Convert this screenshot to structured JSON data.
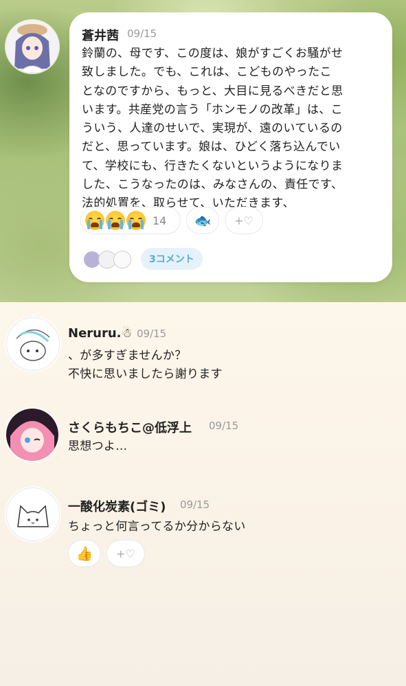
{
  "post": {
    "author": "蒼井茜",
    "date": "09/15",
    "lines": [
      "鈴蘭の、母です、この度は、娘がすごくお騒がせ",
      "致しました。でも、これは、こどものやったこ",
      "となのですから、もっと、大目に見るべきだと思",
      "います。共産党の言う「ホンモノの改革」は、こ",
      "ういう、人達のせいで、実現が、遠のいているの",
      "だと、思っています。娘は、ひどく落ち込んでい",
      "て、学校にも、行きたくないというようになりま",
      "した、こうなったのは、みなさんの、責任です、",
      "法的処置を、取らせて、いただきます、"
    ],
    "reactions": {
      "crying_count": "14",
      "fish_emoji": "🐟",
      "add_label": "+♡"
    },
    "comment_badge": "3コメント"
  },
  "comments": [
    {
      "author": "Neruru.☃",
      "date": "09/15",
      "lines": [
        "、が多すぎませんか？",
        "不快に思いましたら謝ります"
      ]
    },
    {
      "author": "さくらもちこ@低浮上",
      "date": "09/15",
      "lines": [
        "思想つよ..."
      ]
    },
    {
      "author": "一酸化炭素(ゴミ)",
      "date": "09/15",
      "lines": [
        "ちょっと何言ってるか分からない"
      ],
      "reaction_emoji": "👍",
      "add_label": "+♡"
    }
  ]
}
